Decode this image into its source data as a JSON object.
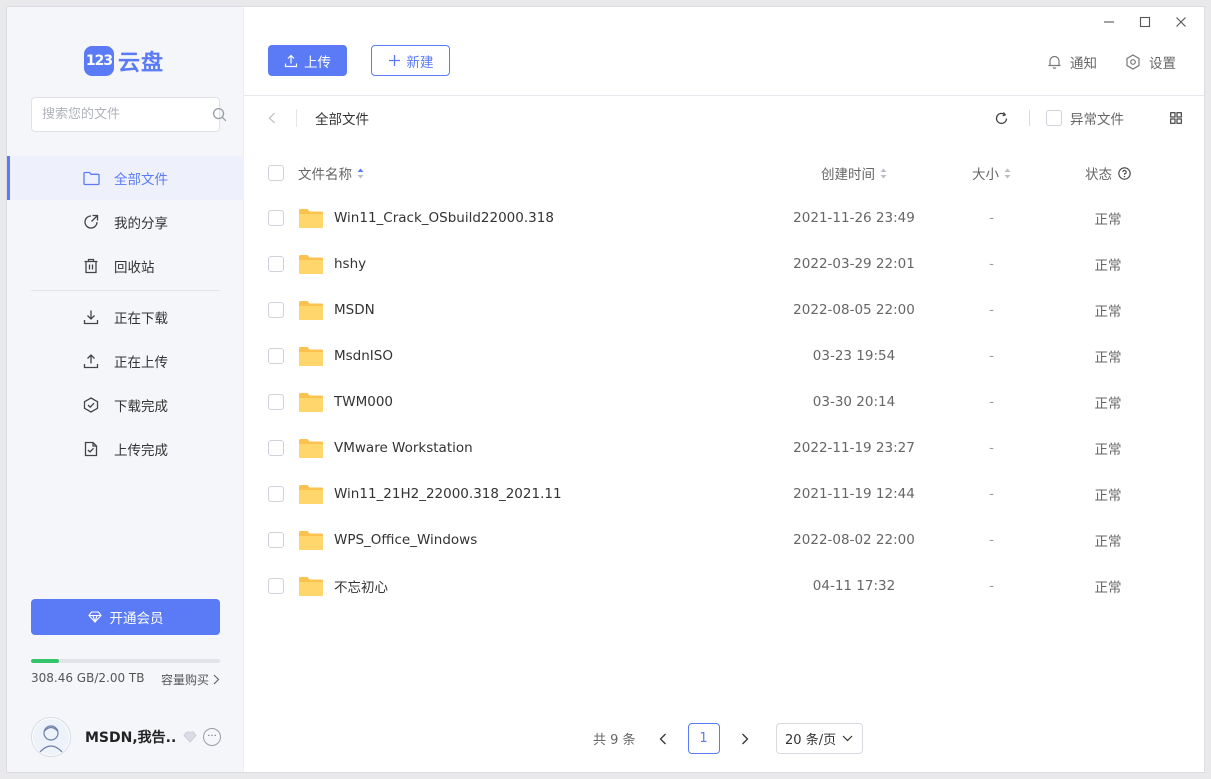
{
  "app": {
    "logo_badge": "123",
    "logo_text": "云盘",
    "accent_color": "#5a7bf5"
  },
  "sidebar": {
    "search_placeholder": "搜索您的文件",
    "nav_primary": [
      {
        "label": "全部文件",
        "icon": "folder-icon",
        "active": true
      },
      {
        "label": "我的分享",
        "icon": "share-icon"
      },
      {
        "label": "回收站",
        "icon": "trash-icon"
      }
    ],
    "nav_transfer": [
      {
        "label": "正在下载",
        "icon": "download-icon"
      },
      {
        "label": "正在上传",
        "icon": "upload-icon"
      },
      {
        "label": "下载完成",
        "icon": "check-circle-icon"
      },
      {
        "label": "上传完成",
        "icon": "file-check-icon"
      }
    ],
    "vip_button": "开通会员",
    "storage": {
      "used_text": "308.46 GB/2.00 TB",
      "used_fraction": 0.15,
      "buy_label": "容量购买",
      "fill_color": "#35c46b"
    },
    "user": {
      "name": "MSDN,我告...",
      "more": "···"
    }
  },
  "toolbar": {
    "upload_label": "上传",
    "new_label": "新建"
  },
  "top_actions": {
    "notify_label": "通知",
    "settings_label": "设置"
  },
  "breadcrumb": {
    "current": "全部文件",
    "abnormal_label": "异常文件"
  },
  "table": {
    "headers": {
      "name": "文件名称",
      "time": "创建时间",
      "size": "大小",
      "status": "状态"
    },
    "rows": [
      {
        "name": "Win11_Crack_OSbuild22000.318",
        "time": "2021-11-26 23:49",
        "size": "-",
        "status": "正常"
      },
      {
        "name": "hshy",
        "time": "2022-03-29 22:01",
        "size": "-",
        "status": "正常"
      },
      {
        "name": "MSDN",
        "time": "2022-08-05 22:00",
        "size": "-",
        "status": "正常"
      },
      {
        "name": "MsdnISO",
        "time": "03-23 19:54",
        "size": "-",
        "status": "正常"
      },
      {
        "name": "TWM000",
        "time": "03-30 20:14",
        "size": "-",
        "status": "正常"
      },
      {
        "name": "VMware Workstation",
        "time": "2022-11-19 23:27",
        "size": "-",
        "status": "正常"
      },
      {
        "name": "Win11_21H2_22000.318_2021.11",
        "time": "2021-11-19 12:44",
        "size": "-",
        "status": "正常"
      },
      {
        "name": "WPS_Office_Windows",
        "time": "2022-08-02 22:00",
        "size": "-",
        "status": "正常"
      },
      {
        "name": "不忘初心",
        "time": "04-11 17:32",
        "size": "-",
        "status": "正常"
      }
    ]
  },
  "pagination": {
    "total": "共 9 条",
    "current_page": "1",
    "page_size": "20 条/页"
  }
}
